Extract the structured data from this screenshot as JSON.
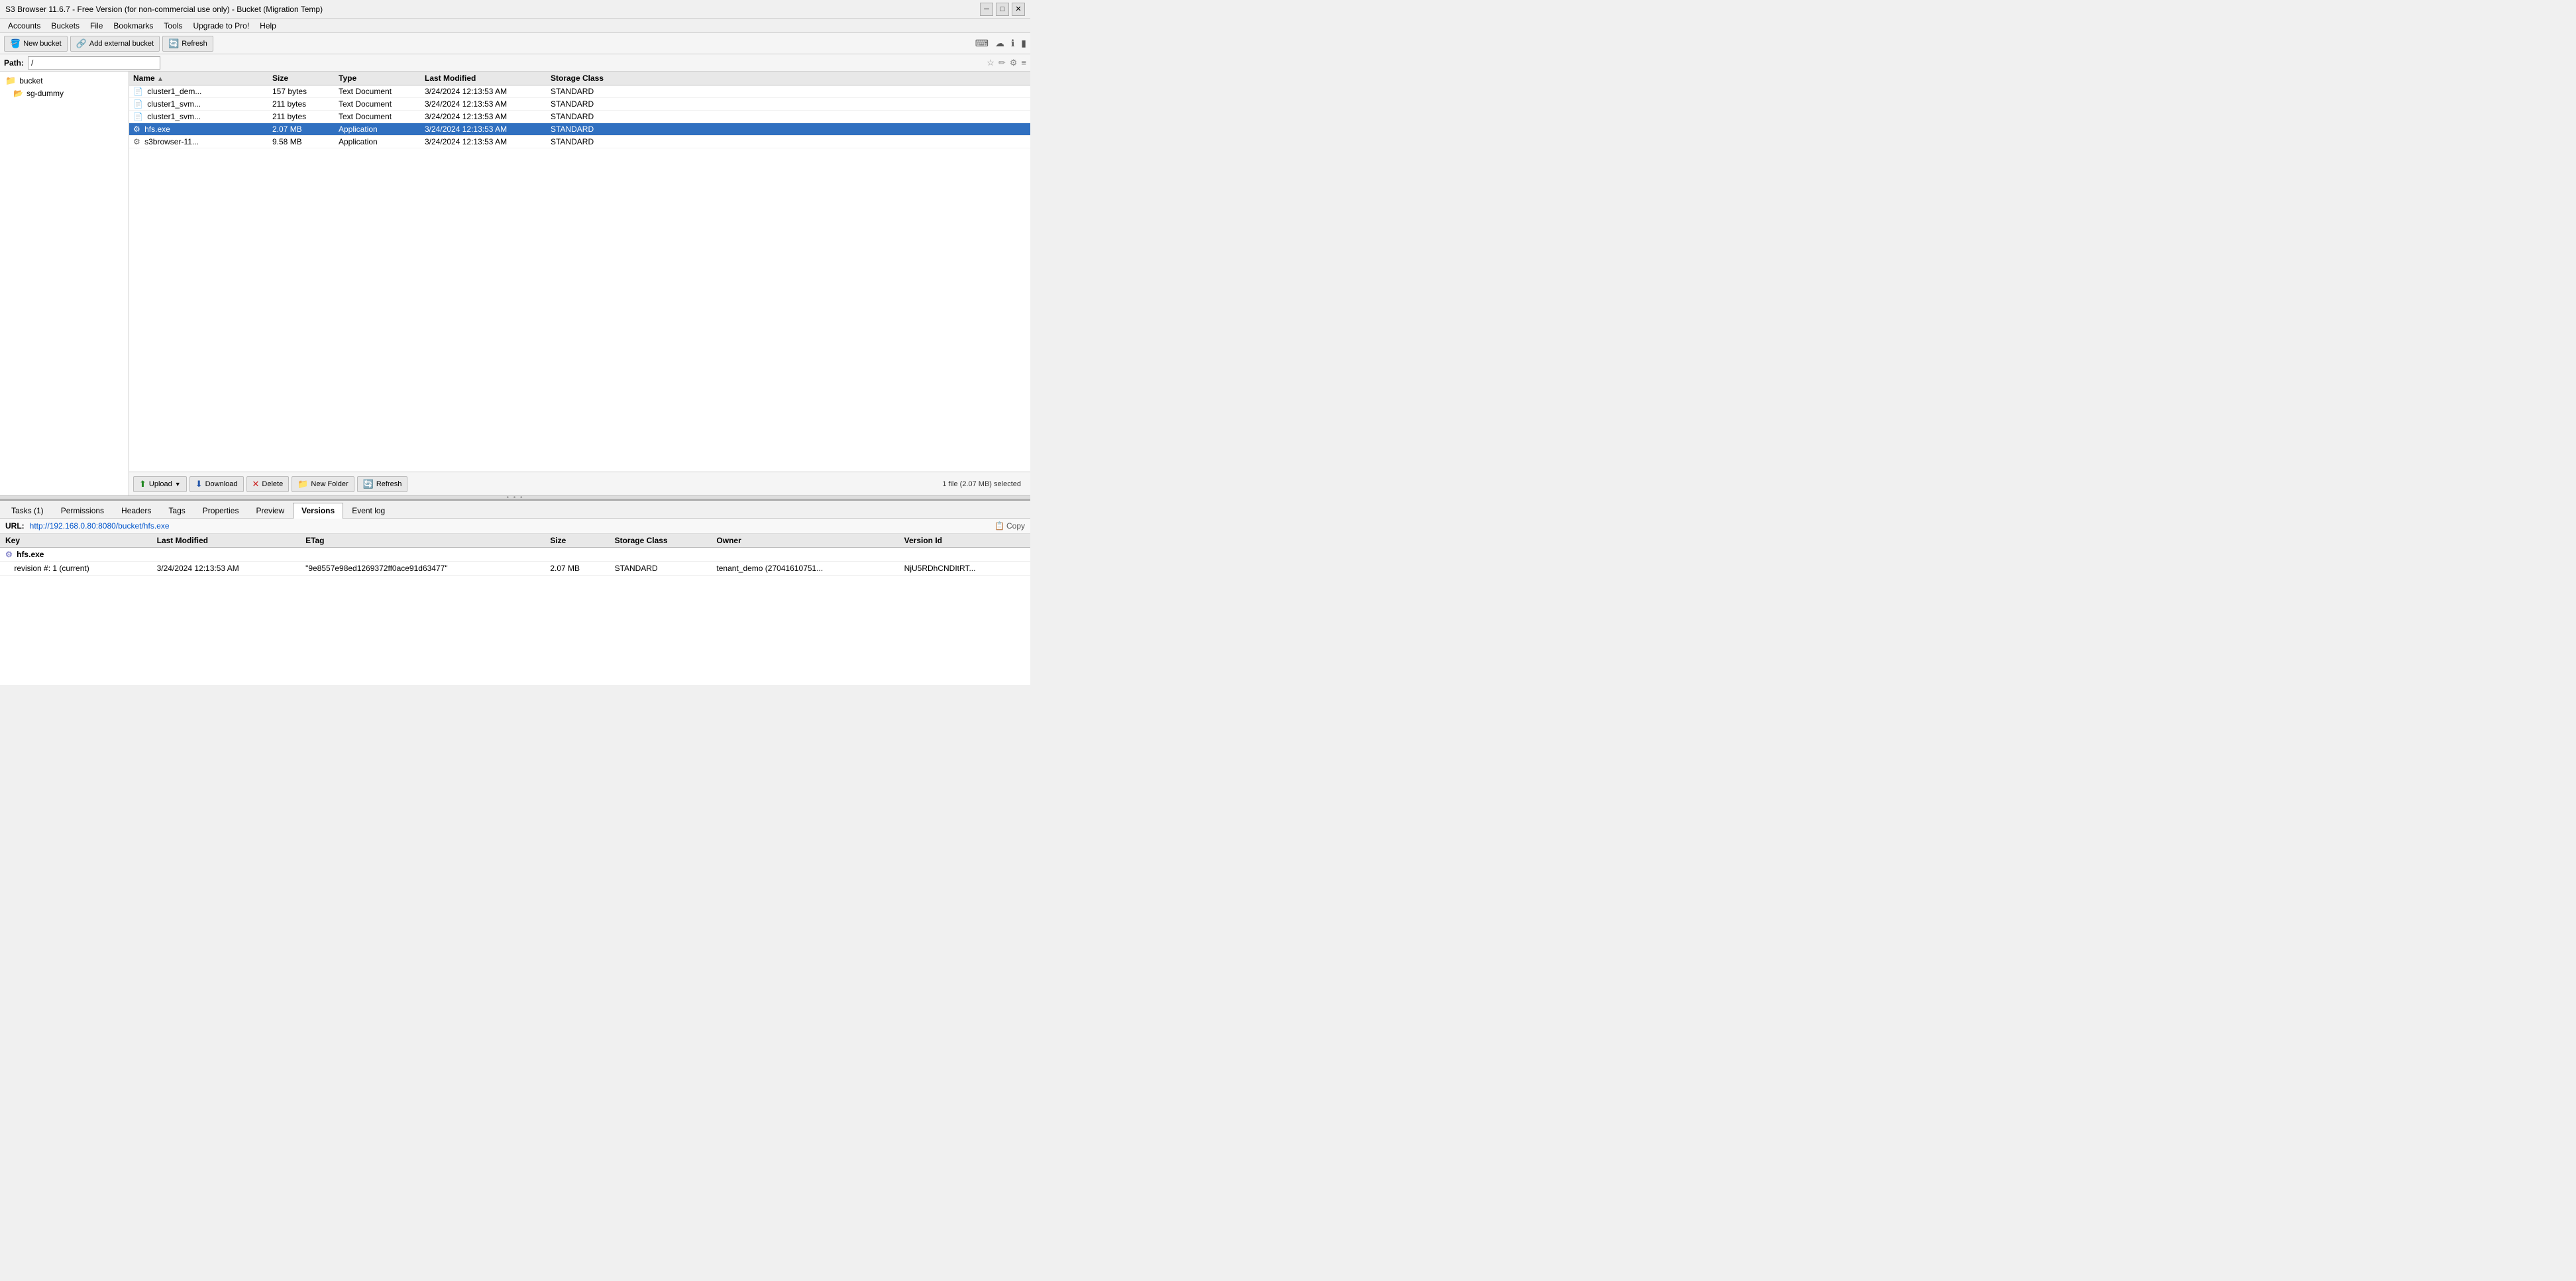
{
  "titlebar": {
    "title": "S3 Browser 11.6.7 - Free Version (for non-commercial use only) - Bucket (Migration Temp)",
    "minimize": "─",
    "restore": "□",
    "close": "✕"
  },
  "menubar": {
    "items": [
      "Accounts",
      "Buckets",
      "File",
      "Bookmarks",
      "Tools",
      "Upgrade to Pro!",
      "Help"
    ]
  },
  "toolbar": {
    "new_bucket": "New bucket",
    "add_external": "Add external bucket",
    "refresh": "Refresh"
  },
  "pathbar": {
    "label": "Path:",
    "value": "/"
  },
  "top_icons": [
    "⌨",
    "☁",
    "ℹ",
    "▮"
  ],
  "sidebar": {
    "items": [
      {
        "name": "bucket",
        "type": "folder"
      },
      {
        "name": "sg-dummy",
        "type": "folder-small"
      }
    ]
  },
  "filelist": {
    "columns": [
      {
        "key": "name",
        "label": "Name"
      },
      {
        "key": "size",
        "label": "Size"
      },
      {
        "key": "type",
        "label": "Type"
      },
      {
        "key": "modified",
        "label": "Last Modified"
      },
      {
        "key": "storage",
        "label": "Storage Class"
      }
    ],
    "rows": [
      {
        "name": "cluster1_dem...",
        "size": "157 bytes",
        "type": "Text Document",
        "modified": "3/24/2024 12:13:53 AM",
        "storage": "STANDARD",
        "icon": "📄",
        "selected": false
      },
      {
        "name": "cluster1_svm...",
        "size": "211 bytes",
        "type": "Text Document",
        "modified": "3/24/2024 12:13:53 AM",
        "storage": "STANDARD",
        "icon": "📄",
        "selected": false
      },
      {
        "name": "cluster1_svm...",
        "size": "211 bytes",
        "type": "Text Document",
        "modified": "3/24/2024 12:13:53 AM",
        "storage": "STANDARD",
        "icon": "📄",
        "selected": false
      },
      {
        "name": "hfs.exe",
        "size": "2.07 MB",
        "type": "Application",
        "modified": "3/24/2024 12:13:53 AM",
        "storage": "STANDARD",
        "icon": "⚙",
        "selected": true
      },
      {
        "name": "s3browser-11...",
        "size": "9.58 MB",
        "type": "Application",
        "modified": "3/24/2024 12:13:53 AM",
        "storage": "STANDARD",
        "icon": "⚙",
        "selected": false
      }
    ],
    "status": "1 file (2.07 MB) selected"
  },
  "filelist_toolbar": {
    "upload": "Upload",
    "download": "Download",
    "delete": "Delete",
    "new_folder": "New Folder",
    "refresh": "Refresh"
  },
  "bottom_panel": {
    "tabs": [
      "Tasks (1)",
      "Permissions",
      "Headers",
      "Tags",
      "Properties",
      "Preview",
      "Versions",
      "Event log"
    ],
    "active_tab": "Versions",
    "url": {
      "label": "URL:",
      "value": "http://192.168.0.80:8080/bucket/hfs.exe",
      "copy_label": "Copy"
    },
    "versions_table": {
      "columns": [
        "Key",
        "Last Modified",
        "ETag",
        "Size",
        "Storage Class",
        "Owner",
        "Version Id"
      ],
      "file_row": {
        "key": "hfs.exe",
        "revision": "revision #: 1 (current)",
        "last_modified": "3/24/2024 12:13:53 AM",
        "etag": "\"9e8557e98ed1269372ff0ace91d63477\"",
        "size": "2.07 MB",
        "storage_class": "STANDARD",
        "owner": "tenant_demo (27041610751...",
        "version_id": "NjU5RDhCNDItRT..."
      }
    }
  }
}
